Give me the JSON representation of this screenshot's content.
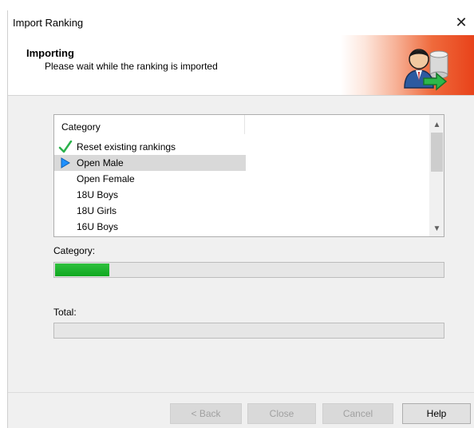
{
  "window": {
    "title": "Import Ranking",
    "close_glyph": "✕"
  },
  "header": {
    "title": "Importing",
    "subtitle": "Please wait while the ranking is imported",
    "banner_icon": "user-database-import-icon"
  },
  "list": {
    "column_header": "Category",
    "items": [
      {
        "label": "Reset existing rankings",
        "state": "done"
      },
      {
        "label": "Open Male",
        "state": "current"
      },
      {
        "label": "Open Female",
        "state": "pending"
      },
      {
        "label": "18U Boys",
        "state": "pending"
      },
      {
        "label": "18U Girls",
        "state": "pending"
      },
      {
        "label": "16U Boys",
        "state": "pending"
      }
    ],
    "scroll_up_glyph": "▲",
    "scroll_down_glyph": "▼"
  },
  "progress": {
    "category_label": "Category:",
    "category_fraction": 0.14,
    "total_label": "Total:",
    "total_fraction": 0
  },
  "buttons": {
    "back": "< Back",
    "close": "Close",
    "cancel": "Cancel",
    "help": "Help"
  },
  "colors": {
    "progress_green": "#13ab22",
    "checkmark": "#2bb24c",
    "arrow": "#1e90ff",
    "banner_accent": "#e8421a"
  }
}
